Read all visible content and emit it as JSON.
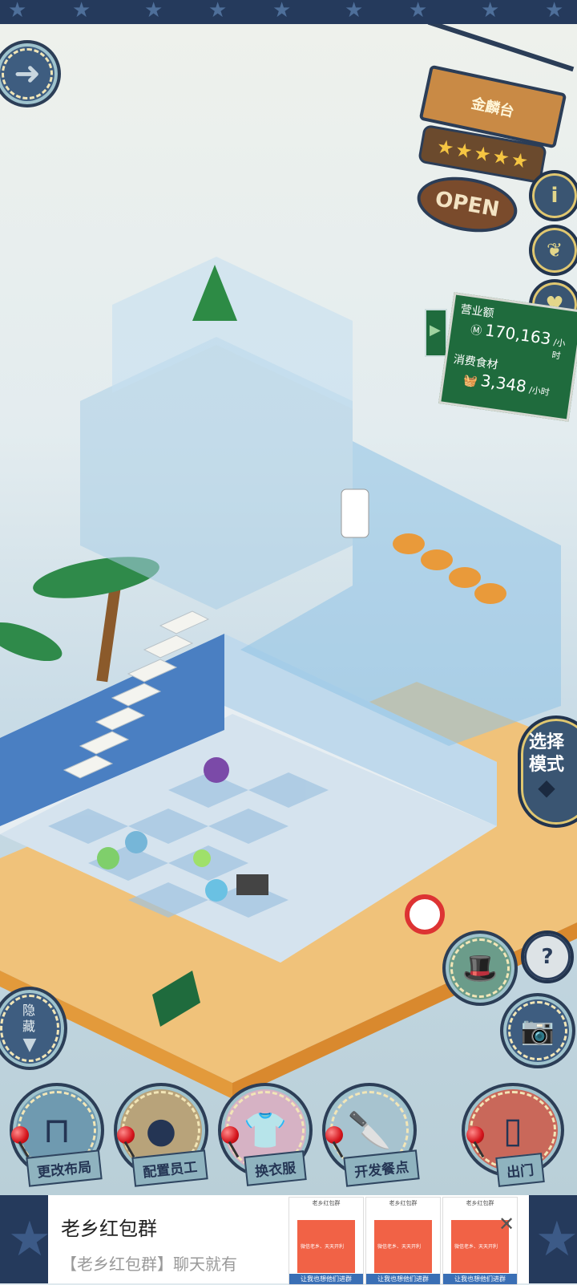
{
  "shop": {
    "name": "金麟台",
    "open_sign": "OPEN",
    "stars": 5
  },
  "stats": {
    "revenue_label": "营业额",
    "revenue_value": "170,163",
    "revenue_unit": "/小时",
    "food_label": "消费食材",
    "food_value": "3,348",
    "food_unit": "/小时"
  },
  "buttons": {
    "select_mode": "选择模式",
    "hide": "隐藏",
    "help_symbol": "?",
    "info_symbol": "i"
  },
  "bottom_menu": [
    {
      "label": "更改布局",
      "icon": "table-icon"
    },
    {
      "label": "配置员工",
      "icon": "bear-head-icon"
    },
    {
      "label": "换衣服",
      "icon": "shirt-icon"
    },
    {
      "label": "开发餐点",
      "icon": "knife-icon"
    },
    {
      "label": "出门",
      "icon": "door-icon"
    }
  ],
  "ad": {
    "title": "老乡红包群",
    "subtitle": "【老乡红包群】聊天就有",
    "thumbs": [
      {
        "header": "老乡红包群",
        "body": "微信老乡、天天开利",
        "footer": "让我也想他们进群"
      },
      {
        "header": "老乡红包群",
        "body": "微信老乡、天天开利",
        "footer": "让我也想他们进群"
      },
      {
        "header": "老乡红包群",
        "body": "微信老乡、天天开利",
        "footer": "让我也想他们进群"
      }
    ]
  },
  "colors": {
    "frame": "#253a5c",
    "sign_wood": "#c98a45",
    "chalkboard": "#1f6b3d",
    "ad_red": "#f16246"
  }
}
